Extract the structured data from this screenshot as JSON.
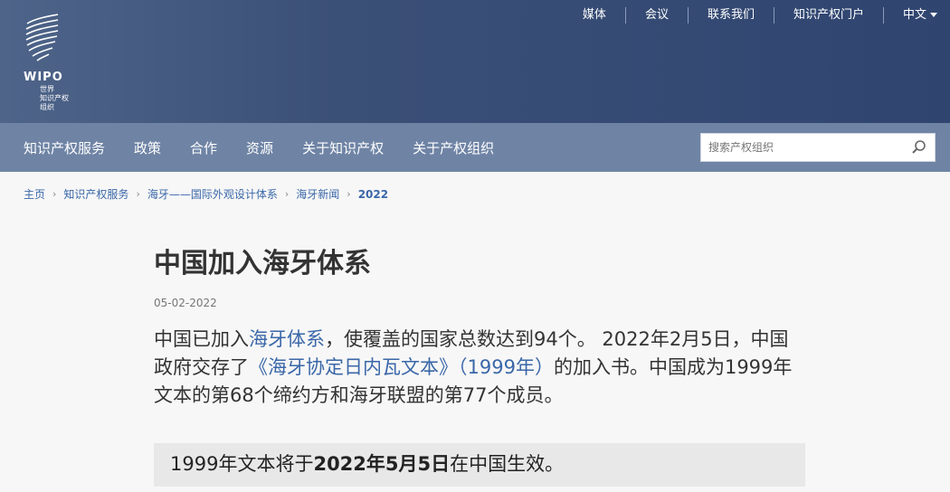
{
  "logo": {
    "name": "WIPO",
    "subtitle_lines": [
      "世界",
      "知识产权",
      "组织"
    ]
  },
  "top_nav": [
    {
      "label": "媒体"
    },
    {
      "label": "会议"
    },
    {
      "label": "联系我们"
    },
    {
      "label": "知识产权门户"
    },
    {
      "label": "中文"
    }
  ],
  "main_nav": [
    {
      "label": "知识产权服务"
    },
    {
      "label": "政策"
    },
    {
      "label": "合作"
    },
    {
      "label": "资源"
    },
    {
      "label": "关于知识产权"
    },
    {
      "label": "关于产权组织"
    }
  ],
  "search": {
    "placeholder": "搜索产权组织"
  },
  "breadcrumb": [
    {
      "label": "主页"
    },
    {
      "label": "知识产权服务"
    },
    {
      "label": "海牙——国际外观设计体系"
    },
    {
      "label": "海牙新闻"
    },
    {
      "label": "2022"
    }
  ],
  "article": {
    "title": "中国加入海牙体系",
    "date": "05-02-2022",
    "lead": {
      "part1": "中国已加入",
      "link1": "海牙体系",
      "part2": "，使覆盖的国家总数达到94个。 2022年2月5日，中国政府交存了",
      "link2": "《海牙协定日内瓦文本》（1999年）",
      "part3": "的加入书。中国成为1999年文本的第68个缔约方和海牙联盟的第77个成员。"
    },
    "notice": {
      "before": "1999年文本将于",
      "bold": "2022年5月5日",
      "after": "在中国生效。"
    }
  },
  "colors": {
    "header_bg": "#3b5077",
    "nav_bg": "#6f84a5",
    "link": "#3a67a8"
  }
}
